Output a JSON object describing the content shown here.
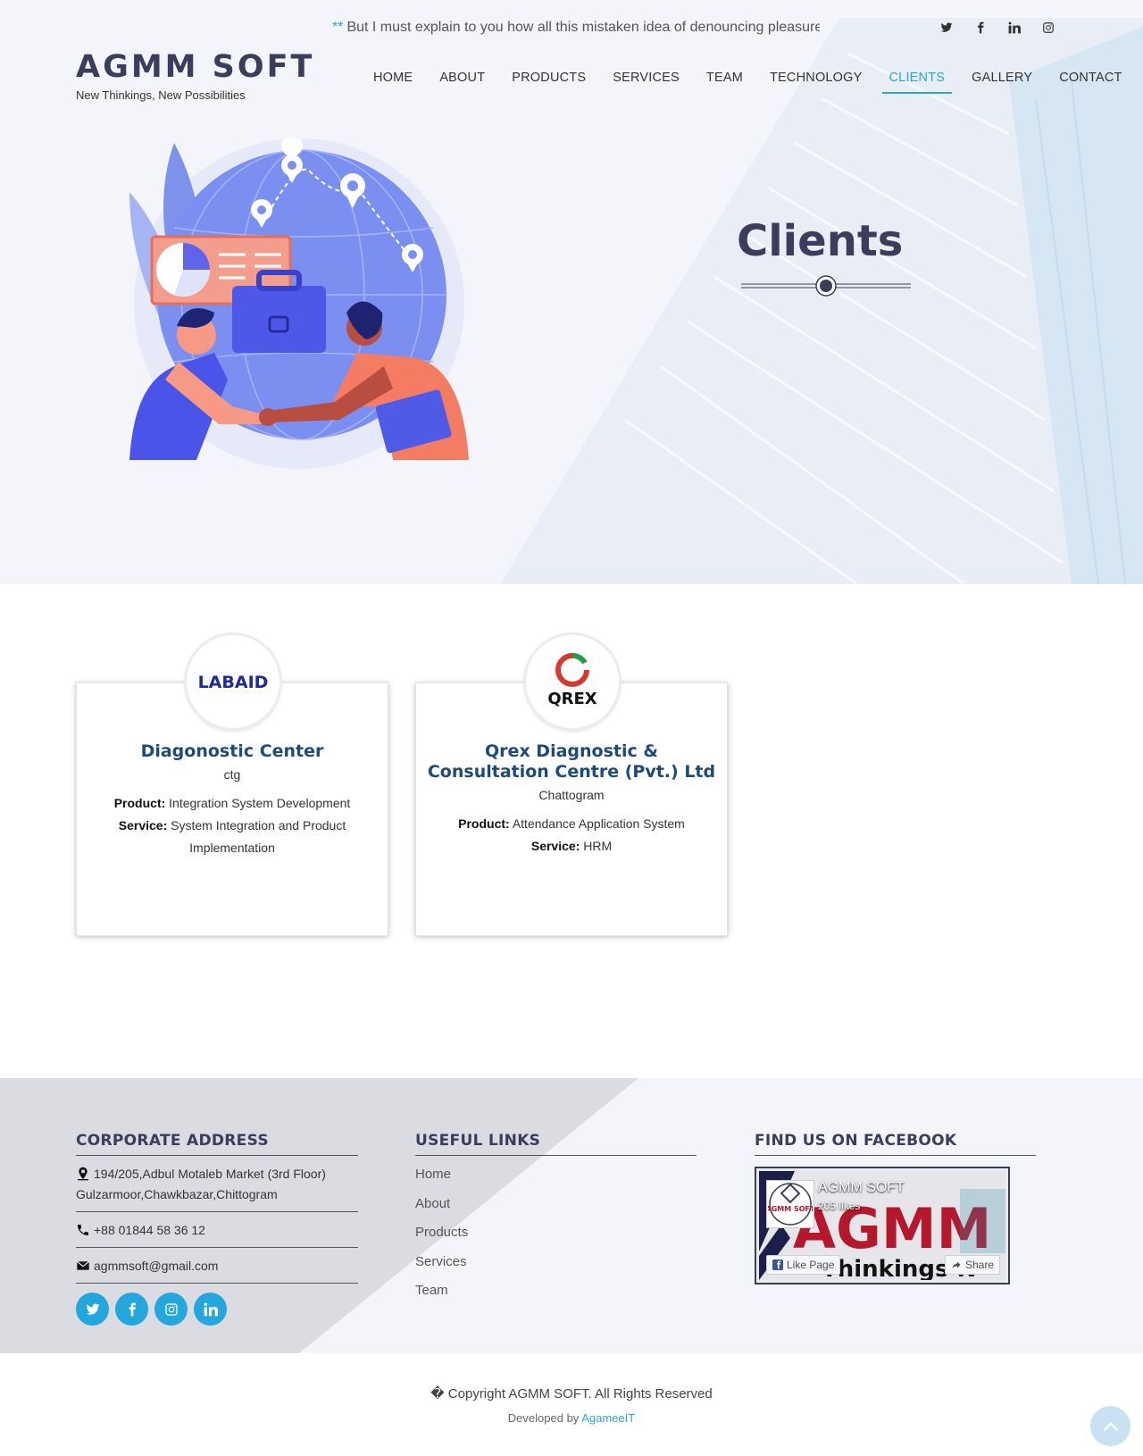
{
  "ticker": {
    "stars": "**",
    "text": "But I must explain to you how all this mistaken idea of denouncing pleasure and praising pain was born"
  },
  "top_social": [
    "twitter-icon",
    "facebook-icon",
    "linkedin-icon",
    "instagram-icon"
  ],
  "brand": {
    "title": "AGMM SOFT",
    "tagline": "New Thinkings, New Possibilities"
  },
  "nav": {
    "items": [
      {
        "label": "HOME"
      },
      {
        "label": "ABOUT"
      },
      {
        "label": "PRODUCTS"
      },
      {
        "label": "SERVICES"
      },
      {
        "label": "TEAM"
      },
      {
        "label": "TECHNOLOGY"
      },
      {
        "label": "CLIENTS"
      },
      {
        "label": "GALLERY"
      },
      {
        "label": "CONTACT"
      }
    ],
    "active": "CLIENTS"
  },
  "hero": {
    "title": "Clients"
  },
  "clients": [
    {
      "logo_text": "LABAID",
      "name": "Diagonostic Center",
      "location": "ctg",
      "product_label": "Product:",
      "product": "Integration System Development",
      "service_label": "Service:",
      "service": "System Integration and Product Implementation"
    },
    {
      "logo_text": "QREX",
      "name": "Qrex Diagnostic & Consultation Centre (Pvt.) Ltd",
      "location": "Chattogram",
      "product_label": "Product:",
      "product": "Attendance Application System",
      "service_label": "Service:",
      "service": "HRM"
    }
  ],
  "footer": {
    "address": {
      "heading": "CORPORATE ADDRESS",
      "line1": "194/205,Adbul Motaleb Market (3rd Floor)",
      "line2": "Gulzarmoor,Chawkbazar,Chittogram",
      "phone": "+88 01844 58 36 12",
      "email": "agmmsoft@gmail.com"
    },
    "links": {
      "heading": "USEFUL LINKS",
      "items": [
        {
          "label": "Home"
        },
        {
          "label": "About"
        },
        {
          "label": "Products"
        },
        {
          "label": "Services"
        },
        {
          "label": "Team"
        }
      ]
    },
    "facebook": {
      "heading": "FIND US ON FACEBOOK",
      "page_name": "AGMM SOFT",
      "likes": "205 likes",
      "cover_big": "AGMM S",
      "cover_small": "Thinkings N",
      "avatar_text": "AGMM SOFT",
      "like_button": "Like Page",
      "share_button": "Share"
    },
    "social": [
      "twitter-icon",
      "facebook-icon",
      "instagram-icon",
      "linkedin-icon"
    ],
    "copyright": "� Copyright AGMM SOFT. All Rights Reserved",
    "developed_by": "Developed by",
    "developer": "AgameeIT"
  },
  "colors": {
    "accent": "#2ba6d9",
    "heading": "#3a3d5c",
    "client_name": "#1d4a7a",
    "social_bg": "#24a7dc"
  }
}
